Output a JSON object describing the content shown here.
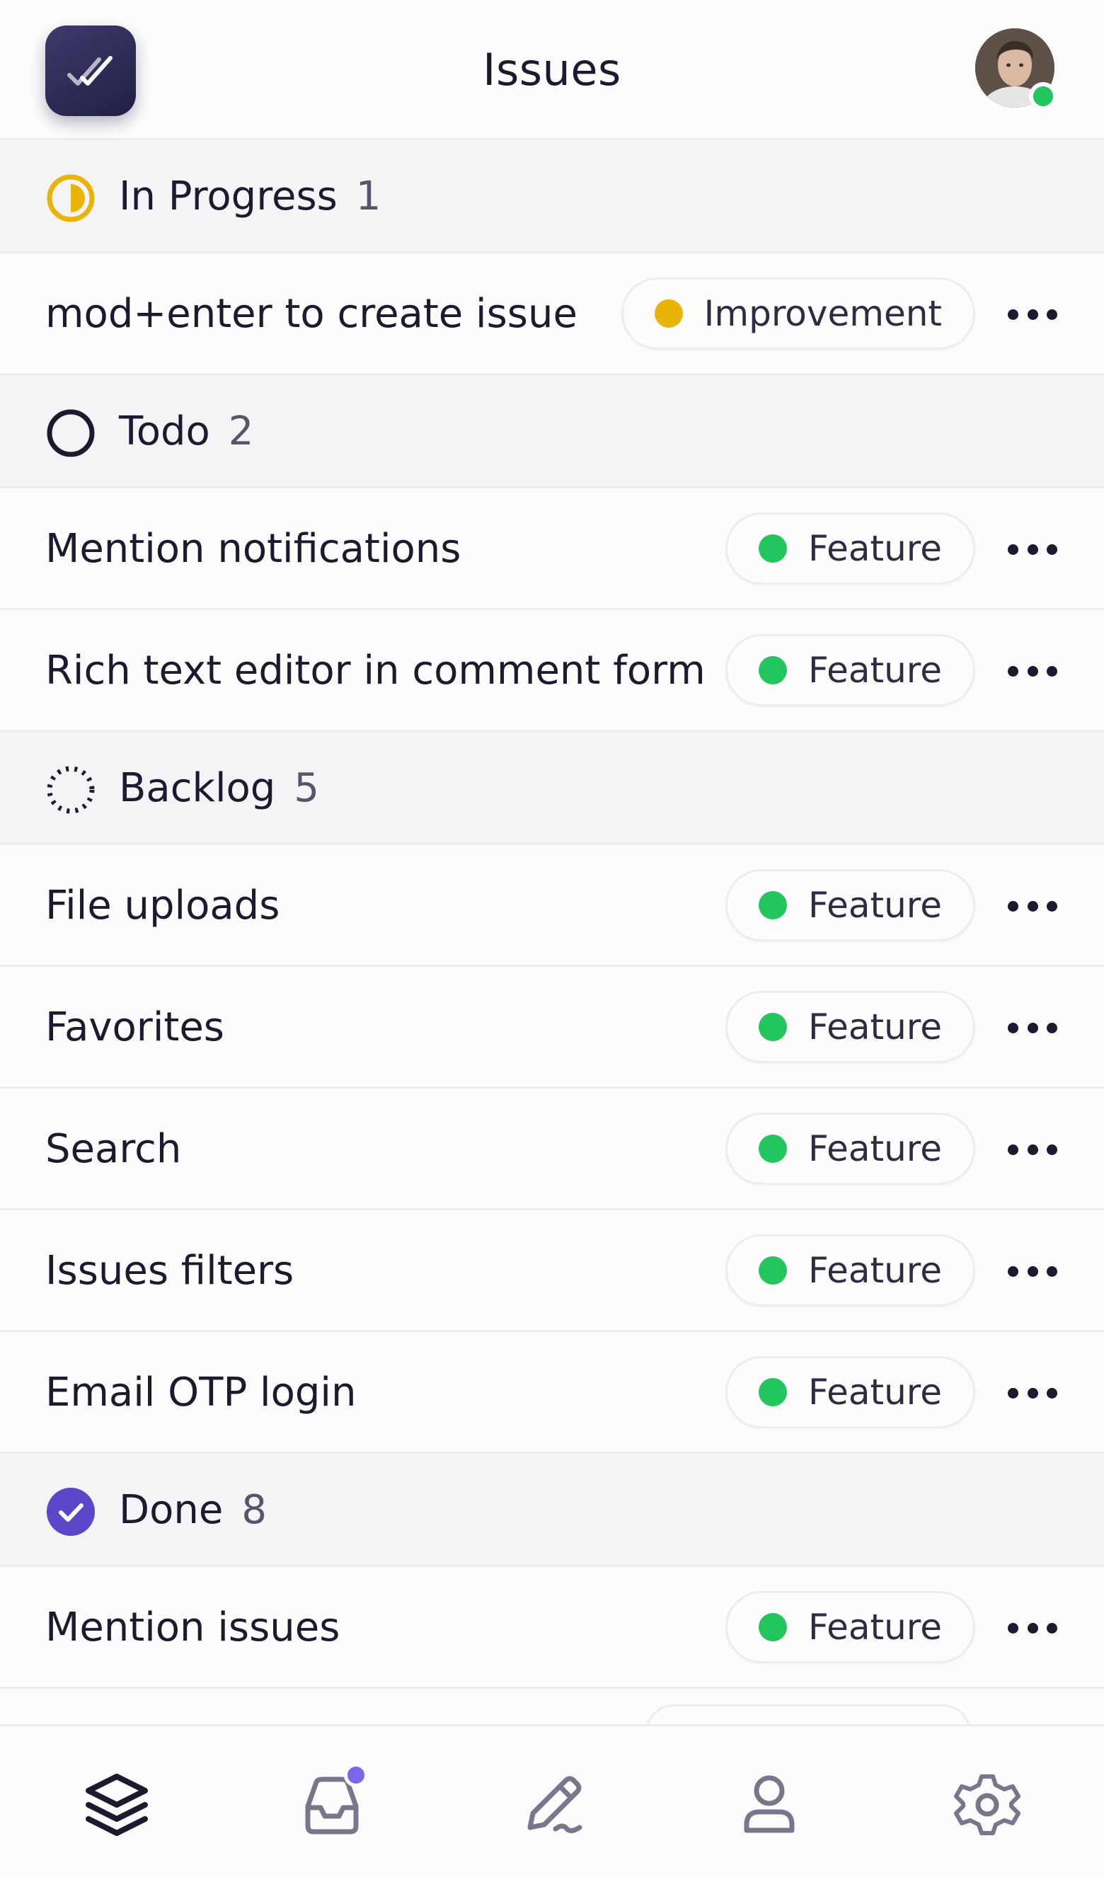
{
  "header": {
    "title": "Issues",
    "logo_icon": "double-check-icon",
    "avatar_status": "online"
  },
  "colors": {
    "feature": "#22c55e",
    "improvement": "#eab308",
    "in_progress": "#eab308",
    "done": "#5b45c9",
    "accent": "#7a66e8"
  },
  "groups": [
    {
      "label": "In Progress",
      "count": "1",
      "icon": "in-progress-icon",
      "issues": [
        {
          "title": "mod+enter to create issue",
          "label": "Improvement",
          "label_color": "#eab308"
        }
      ]
    },
    {
      "label": "Todo",
      "count": "2",
      "icon": "todo-icon",
      "issues": [
        {
          "title": "Mention notifications",
          "label": "Feature",
          "label_color": "#22c55e"
        },
        {
          "title": "Rich text editor in comment form",
          "label": "Feature",
          "label_color": "#22c55e"
        }
      ]
    },
    {
      "label": "Backlog",
      "count": "5",
      "icon": "backlog-icon",
      "issues": [
        {
          "title": "File uploads",
          "label": "Feature",
          "label_color": "#22c55e"
        },
        {
          "title": "Favorites",
          "label": "Feature",
          "label_color": "#22c55e"
        },
        {
          "title": "Search",
          "label": "Feature",
          "label_color": "#22c55e"
        },
        {
          "title": "Issues filters",
          "label": "Feature",
          "label_color": "#22c55e"
        },
        {
          "title": "Email OTP login",
          "label": "Feature",
          "label_color": "#22c55e"
        }
      ]
    },
    {
      "label": "Done",
      "count": "8",
      "icon": "done-icon",
      "issues": [
        {
          "title": "Mention issues",
          "label": "Feature",
          "label_color": "#22c55e"
        }
      ]
    }
  ],
  "bottom_nav": [
    {
      "name": "issues",
      "icon": "layers-icon",
      "active": true
    },
    {
      "name": "inbox",
      "icon": "inbox-icon",
      "has_notification": true
    },
    {
      "name": "create",
      "icon": "pencil-icon"
    },
    {
      "name": "profile",
      "icon": "user-icon"
    },
    {
      "name": "settings",
      "icon": "settings-icon"
    }
  ]
}
